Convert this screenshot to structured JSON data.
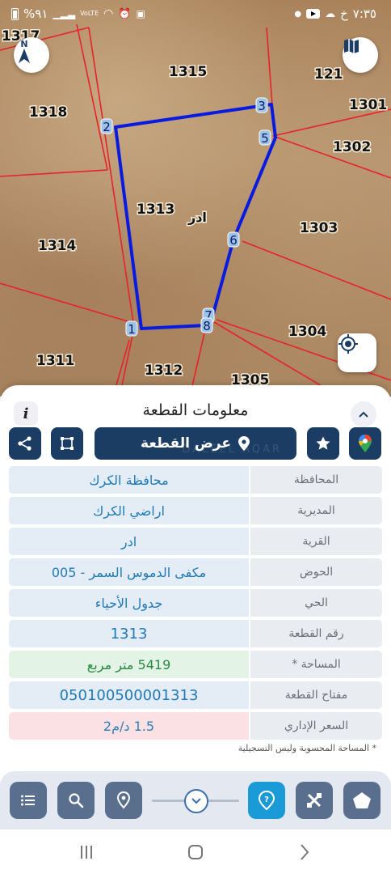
{
  "status_bar": {
    "time": "٧:٣٥",
    "carrier_indicator": "خ",
    "battery": "%٩١"
  },
  "map": {
    "parcels": [
      {
        "no": "1317"
      },
      {
        "no": "1315"
      },
      {
        "no": "121"
      },
      {
        "no": "1318"
      },
      {
        "no": "1301"
      },
      {
        "no": "1302"
      },
      {
        "no": "1313"
      },
      {
        "no": "1303"
      },
      {
        "no": "1314"
      },
      {
        "no": "1304"
      },
      {
        "no": "1311"
      },
      {
        "no": "1312"
      },
      {
        "no": "1305"
      }
    ],
    "village_label": "ادر",
    "vertices": [
      "1",
      "2",
      "3",
      "5",
      "6",
      "7",
      "8"
    ],
    "colors": {
      "boundary": "#0a1be0",
      "parcel_lines": "#e8212a"
    }
  },
  "panel": {
    "title": "معلومات القطعة",
    "show_parcel_label": "عرض القطعة",
    "watermark": "DALEEL AQAR",
    "rows": [
      {
        "label": "المحافظة",
        "value": "محافظة الكرك"
      },
      {
        "label": "المديرية",
        "value": "اراضي الكرك"
      },
      {
        "label": "القرية",
        "value": "ادر"
      },
      {
        "label": "الحوض",
        "value": "مكفى الدموس السمر - 005"
      },
      {
        "label": "الحي",
        "value": "جدول الأحياء"
      },
      {
        "label": "رقم القطعة",
        "value": "1313"
      },
      {
        "label": "المساحة *",
        "value": "5419  متر مربع"
      },
      {
        "label": "مفتاح القطعة",
        "value": "050100500001313"
      },
      {
        "label": "السعر الإداري",
        "value": "1.5 د/م2"
      }
    ],
    "footnote": "* المساحة المحسوبة وليس التسجيلية"
  },
  "colors": {
    "accent_dark": "#1c3d63",
    "accent_blue": "#1a9ad6",
    "value_text": "#1f7ab8"
  }
}
